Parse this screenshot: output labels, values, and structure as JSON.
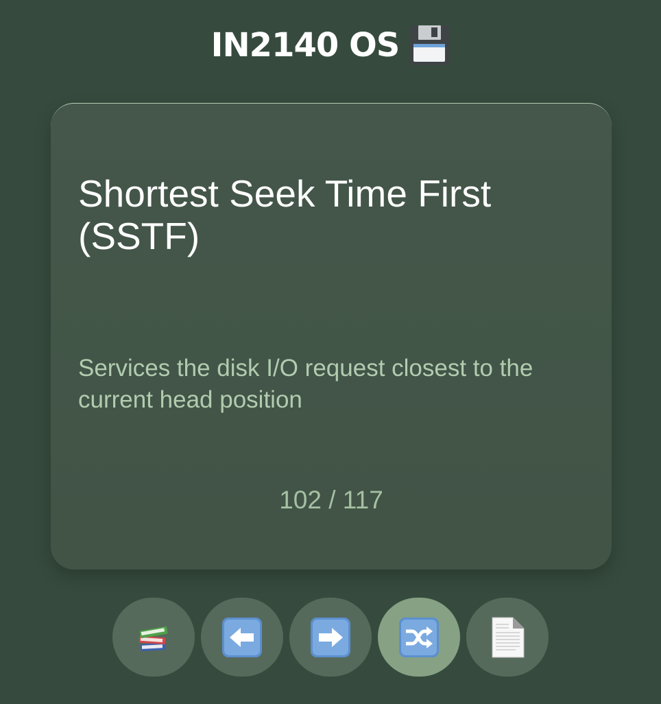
{
  "header": {
    "title": "IN2140 OS",
    "icon": "floppy-disk-icon"
  },
  "card": {
    "term": "Shortest Seek Time First (SSTF)",
    "definition": "Services the disk I/O request closest to the current head position",
    "counter": "102 / 117"
  },
  "controls": {
    "buttons": [
      {
        "name": "decks-button",
        "icon": "books-icon",
        "active": false
      },
      {
        "name": "previous-button",
        "icon": "left-arrow-icon",
        "active": false
      },
      {
        "name": "next-button",
        "icon": "right-arrow-icon",
        "active": false
      },
      {
        "name": "shuffle-button",
        "icon": "shuffle-icon",
        "active": true
      },
      {
        "name": "document-button",
        "icon": "document-icon",
        "active": false
      }
    ]
  },
  "colors": {
    "background": "#364b3d",
    "card": "#435649",
    "title": "#ffffff",
    "definition": "#b2ccaf",
    "counter": "#a6c0a3",
    "button": "#566a5b",
    "button_active": "#86a184"
  }
}
